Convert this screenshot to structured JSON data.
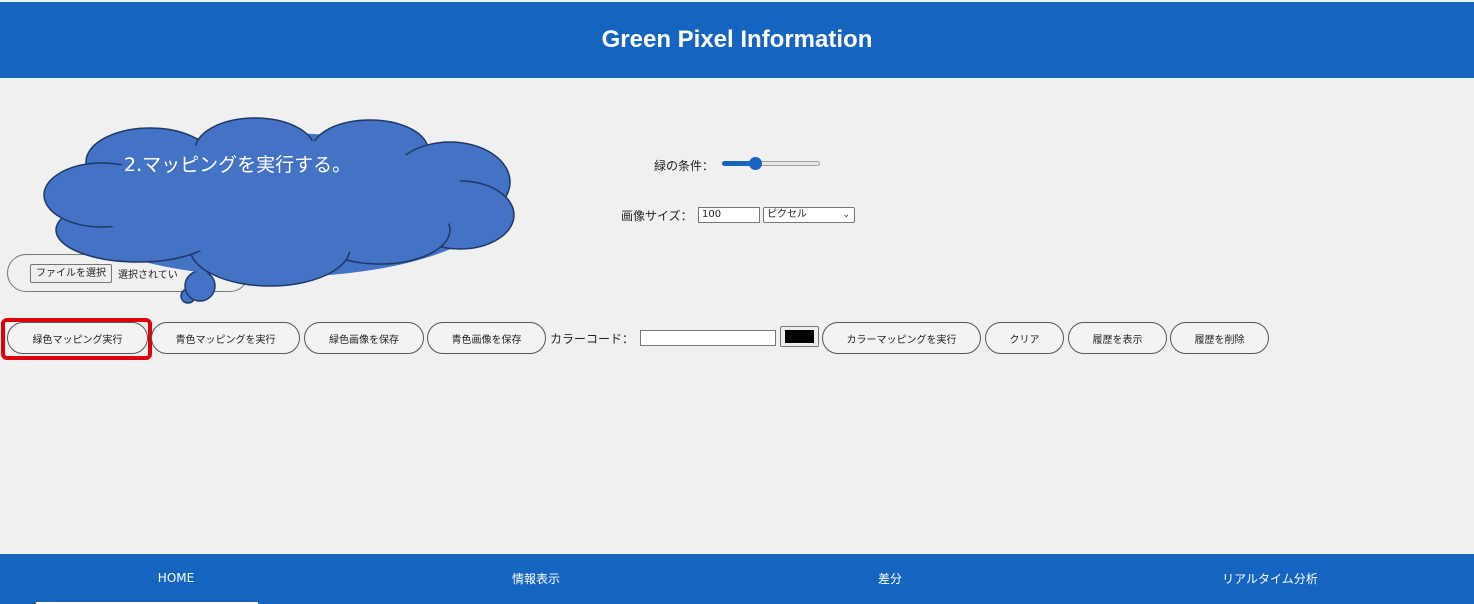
{
  "header": {
    "title": "Green Pixel Information"
  },
  "controls": {
    "green_condition_label": "緑の条件：",
    "green_condition_level": 0.32,
    "image_size_label": "画像サイズ：",
    "image_size_value": "100",
    "unit_selected": "ピクセル"
  },
  "file": {
    "button_label": "ファイルを選択",
    "status_text": "選択されてい"
  },
  "toolbar": {
    "green_mapping": "緑色マッピング実行",
    "blue_mapping": "青色マッピングを実行",
    "save_green": "緑色画像を保存",
    "save_blue": "青色画像を保存",
    "color_code_label": "カラーコード：",
    "color_code_value": "",
    "picked_color": "#000000",
    "color_mapping": "カラーマッピングを実行",
    "clear": "クリア",
    "show_history": "履歴を表示",
    "delete_history": "履歴を削除"
  },
  "callout": {
    "text": "2.マッピングを実行する。",
    "color": "#4472c4"
  },
  "nav": {
    "items": [
      {
        "label": "HOME"
      },
      {
        "label": "情報表示"
      },
      {
        "label": "差分"
      },
      {
        "label": "リアルタイム分析"
      }
    ]
  },
  "colors": {
    "brand": "#1565c0",
    "highlight": "#e0000a"
  }
}
